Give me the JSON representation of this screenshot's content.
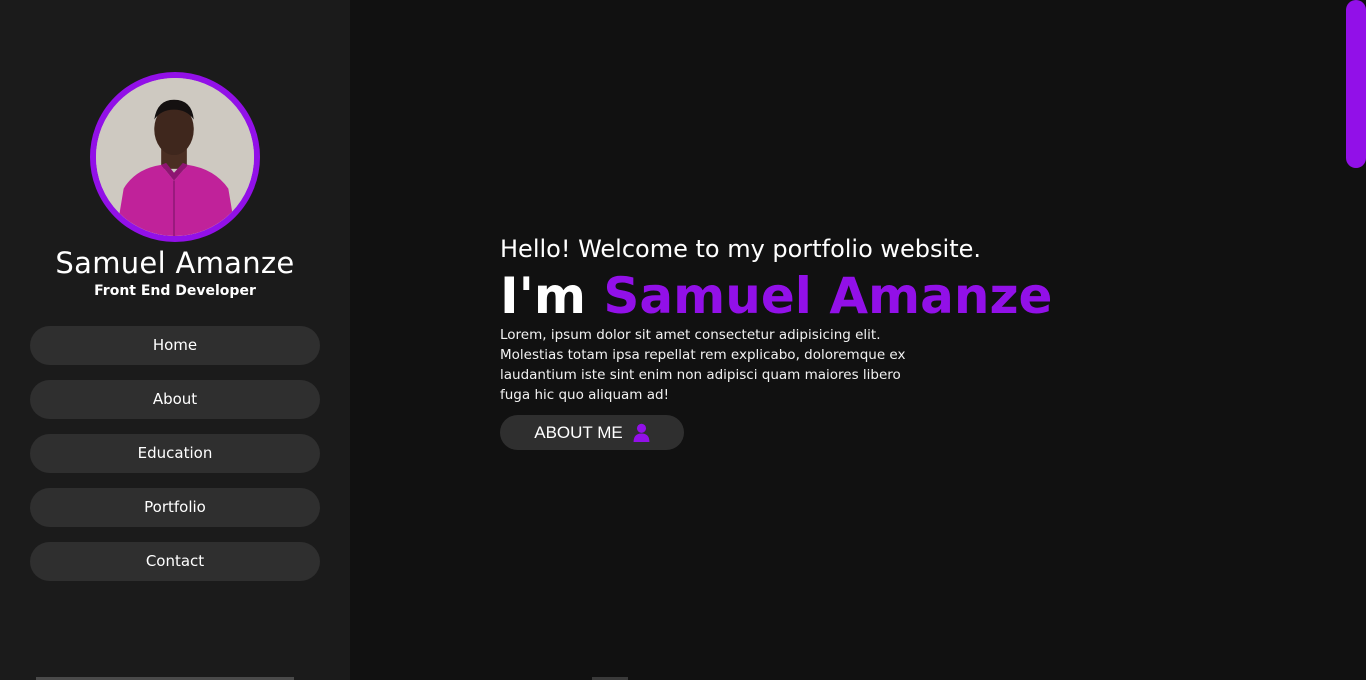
{
  "profile": {
    "name": "Samuel Amanze",
    "role": "Front End Developer"
  },
  "nav": {
    "items": [
      {
        "label": "Home"
      },
      {
        "label": "About"
      },
      {
        "label": "Education"
      },
      {
        "label": "Portfolio"
      },
      {
        "label": "Contact"
      }
    ]
  },
  "hero": {
    "greeting": "Hello! Welcome to my portfolio website.",
    "intro_prefix": "I'm ",
    "intro_name": "Samuel Amanze",
    "description": "Lorem, ipsum dolor sit amet consectetur adipisicing elit. Molestias totam ipsa repellat rem explicabo, doloremque ex laudantium iste sint enim non adipisci quam maiores libero fuga hic quo aliquam ad!",
    "button_label": "ABOUT ME",
    "button_icon": "user-icon"
  },
  "colors": {
    "accent": "#9210e8",
    "background": "#111111",
    "sidebar": "#1b1b1b",
    "button": "#2f2f2f"
  }
}
